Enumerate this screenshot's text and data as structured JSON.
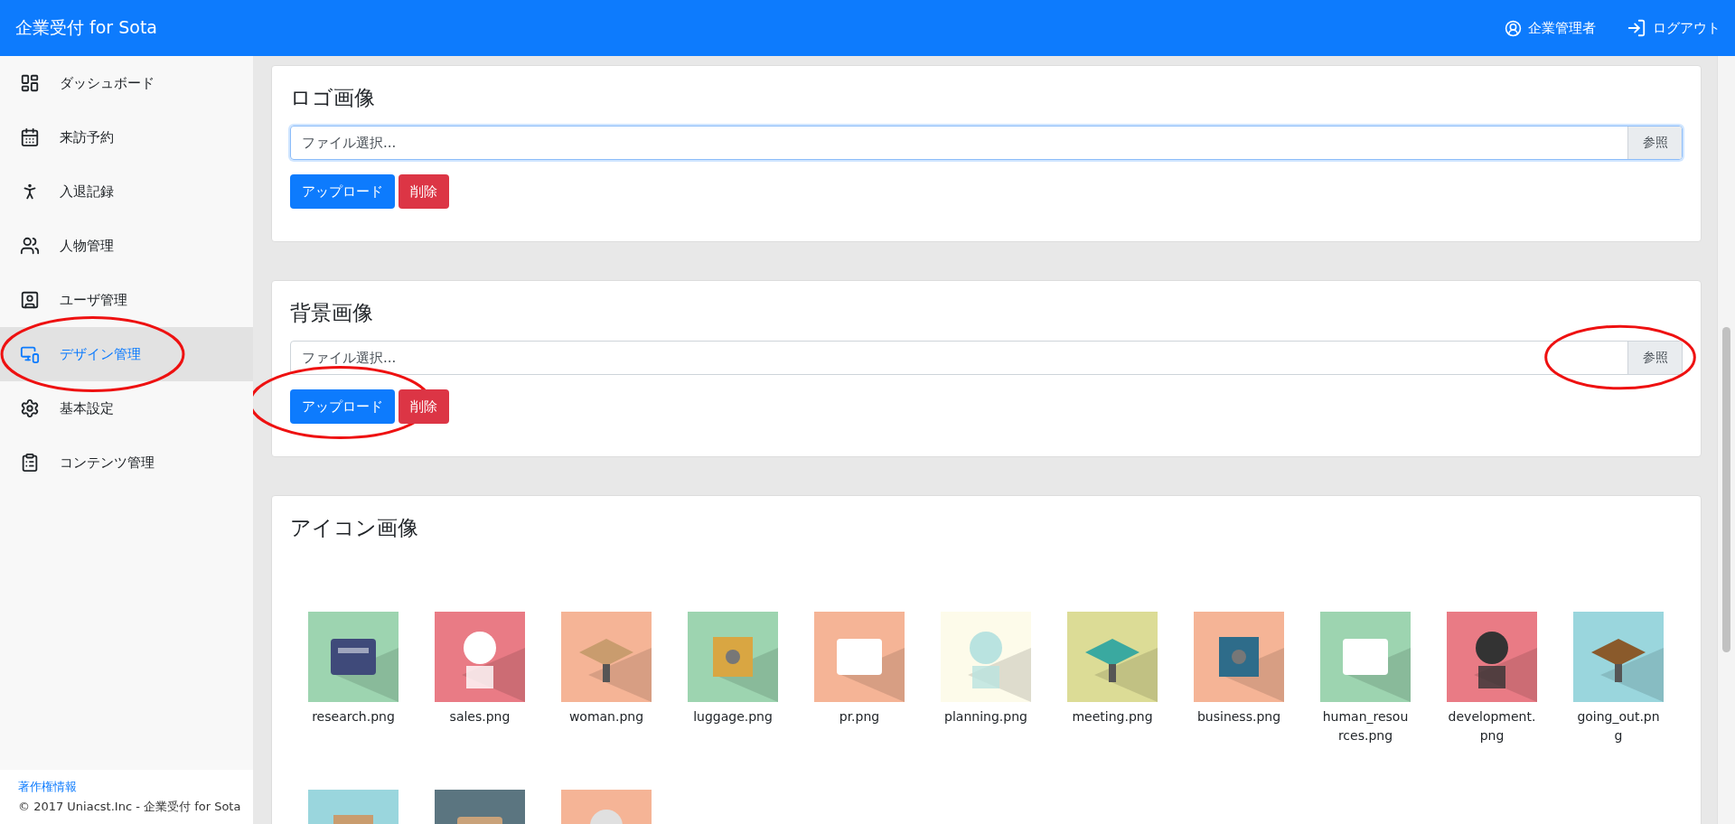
{
  "header": {
    "title": "企業受付 for Sota",
    "user": "企業管理者",
    "logout": "ログアウト"
  },
  "sidebar": {
    "items": [
      {
        "kind": "dashboard",
        "label": "ダッシュボード",
        "selected": false,
        "circled": false
      },
      {
        "kind": "calendar",
        "label": "来訪予約",
        "selected": false,
        "circled": false
      },
      {
        "kind": "walker",
        "label": "入退記録",
        "selected": false,
        "circled": false
      },
      {
        "kind": "people",
        "label": "人物管理",
        "selected": false,
        "circled": false
      },
      {
        "kind": "user",
        "label": "ユーザ管理",
        "selected": false,
        "circled": false
      },
      {
        "kind": "devices",
        "label": "デザイン管理",
        "selected": true,
        "circled": true
      },
      {
        "kind": "gear",
        "label": "基本設定",
        "selected": false,
        "circled": false
      },
      {
        "kind": "clipboard",
        "label": "コンテンツ管理",
        "selected": false,
        "circled": false
      }
    ],
    "footer": {
      "link": "著作権情報",
      "copyright": "© 2017 Uniacst.Inc - 企業受付 for Sota"
    }
  },
  "upload_sections": [
    {
      "title": "ロゴ画像",
      "placeholder": "ファイル選択...",
      "browse": "参照",
      "focused": true,
      "browse_circled": false,
      "upload": "アップロード",
      "upload_circled": false,
      "delete": "削除"
    },
    {
      "title": "背景画像",
      "placeholder": "ファイル選択...",
      "browse": "参照",
      "focused": false,
      "browse_circled": true,
      "upload": "アップロード",
      "upload_circled": true,
      "delete": "削除"
    }
  ],
  "icon_section": {
    "title": "アイコン画像",
    "icons": [
      {
        "kind": "picture",
        "label": "research.png"
      },
      {
        "kind": "picture",
        "label": "sales.png"
      },
      {
        "kind": "picture",
        "label": "woman.png"
      },
      {
        "kind": "picture",
        "label": "luggage.png"
      },
      {
        "kind": "picture",
        "label": "pr.png"
      },
      {
        "kind": "picture",
        "label": "planning.png"
      },
      {
        "kind": "picture",
        "label": "meeting.png"
      },
      {
        "kind": "picture",
        "label": "business.png"
      },
      {
        "kind": "picture",
        "label": "human_resources.png"
      },
      {
        "kind": "picture",
        "label": "development.png"
      },
      {
        "kind": "picture",
        "label": "going_out.png"
      },
      {
        "kind": "picture"
      },
      {
        "kind": "picture"
      },
      {
        "kind": "picture"
      }
    ]
  }
}
